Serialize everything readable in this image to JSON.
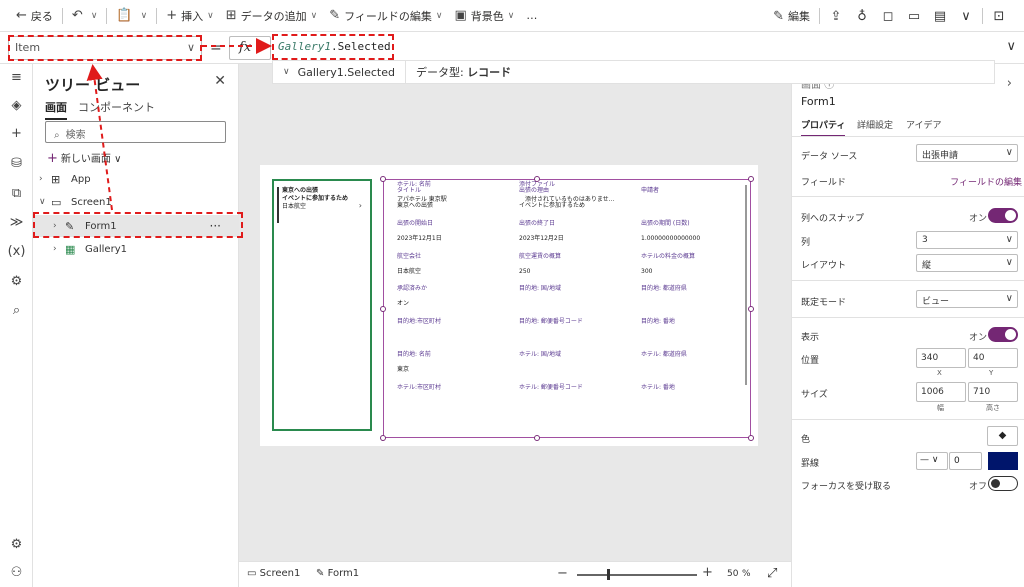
{
  "toolbar": {
    "back": "戻る",
    "insert": "挿入",
    "add_data": "データの追加",
    "edit_fields": "フィールドの編集",
    "background": "背景色",
    "more": "…",
    "edit": "編集"
  },
  "formula_bar": {
    "property": "Item",
    "equals": "=",
    "fx": "fx",
    "formula_control": "Gallery1",
    "formula_rest": ".Selected"
  },
  "formula_hint": {
    "expression": "Gallery1.Selected",
    "datatype_label": "データ型:",
    "datatype_value": "レコード"
  },
  "tree": {
    "title": "ツリー ビュー",
    "tab_screens": "画面",
    "tab_components": "コンポーネント",
    "search_placeholder": "検索",
    "new_screen": "新しい画面",
    "nodes": [
      "App",
      "Screen1",
      "Form1",
      "Gallery1"
    ],
    "more": "···"
  },
  "gallery_item": {
    "title": "東京への出張",
    "subtitle": "イベントに参加するため",
    "body": "日本航空",
    "chevron": "›"
  },
  "form_fields": [
    {
      "label": "タイトル",
      "value": "東京への出張"
    },
    {
      "label": "出張の理由",
      "value": "イベントに参加するため"
    },
    {
      "label": "申請者",
      "value": ""
    },
    {
      "label": "出張の開始日",
      "value": "2023年12月1日"
    },
    {
      "label": "出張の終了日",
      "value": "2023年12月2日"
    },
    {
      "label": "出張の期間 (日数)",
      "value": "1.00000000000000"
    },
    {
      "label": "航空会社",
      "value": "日本航空"
    },
    {
      "label": "航空運賃の概算",
      "value": "250"
    },
    {
      "label": "ホテルの料金の概算",
      "value": "300"
    },
    {
      "label": "承認済みか",
      "value": "オン"
    },
    {
      "label": "目的地: 国/地域",
      "value": ""
    },
    {
      "label": "目的地: 都道府県",
      "value": ""
    },
    {
      "label": "目的地:市区町村",
      "value": ""
    },
    {
      "label": "目的地: 郵便番号コード",
      "value": ""
    },
    {
      "label": "目的地: 番地",
      "value": ""
    },
    {
      "label": "目的地: 名前",
      "value": "東京"
    },
    {
      "label": "ホテル: 国/地域",
      "value": ""
    },
    {
      "label": "ホテル: 都道府県",
      "value": ""
    },
    {
      "label": "ホテル:市区町村",
      "value": ""
    },
    {
      "label": "ホテル: 郵便番号コード",
      "value": ""
    },
    {
      "label": "ホテル: 番地",
      "value": ""
    },
    {
      "label": "ホテル: 名前",
      "value": "アパホテル 東京駅"
    },
    {
      "label": "添付ファイル",
      "value": "添付されているものはありませ..."
    }
  ],
  "statusbar": {
    "screen": "Screen1",
    "form": "Form1",
    "zoom_minus": "−",
    "zoom_plus": "+",
    "zoom_value": "50",
    "zoom_unit": "%",
    "zoom_fraction": 0.25
  },
  "props": {
    "type_label": "画面",
    "name": "Form1",
    "tabs": [
      "プロパティ",
      "詳細設定",
      "アイデア"
    ],
    "data_source_label": "データ ソース",
    "data_source_value": "出張申請",
    "fields_label": "フィールド",
    "fields_link": "フィールドの編集",
    "snap_label": "列へのスナップ",
    "snap_state": "オン",
    "columns_label": "列",
    "columns_value": "3",
    "layout_label": "レイアウト",
    "layout_value": "縦",
    "default_mode_label": "既定モード",
    "default_mode_value": "ビュー",
    "visible_label": "表示",
    "visible_state": "オン",
    "position_label": "位置",
    "position_x": "340",
    "position_y": "40",
    "x_label": "X",
    "y_label": "Y",
    "size_label": "サイズ",
    "size_w": "1006",
    "size_h": "710",
    "w_label": "幅",
    "h_label": "高さ",
    "color_label": "色",
    "border_label": "罫線",
    "border_width": "0",
    "border_color": "#00156b",
    "focus_label": "フォーカスを受け取る",
    "focus_state": "オフ"
  },
  "colors": {
    "accent": "#742774",
    "annotation": "#e01b1b",
    "gallery_border": "#2a8a4e"
  }
}
